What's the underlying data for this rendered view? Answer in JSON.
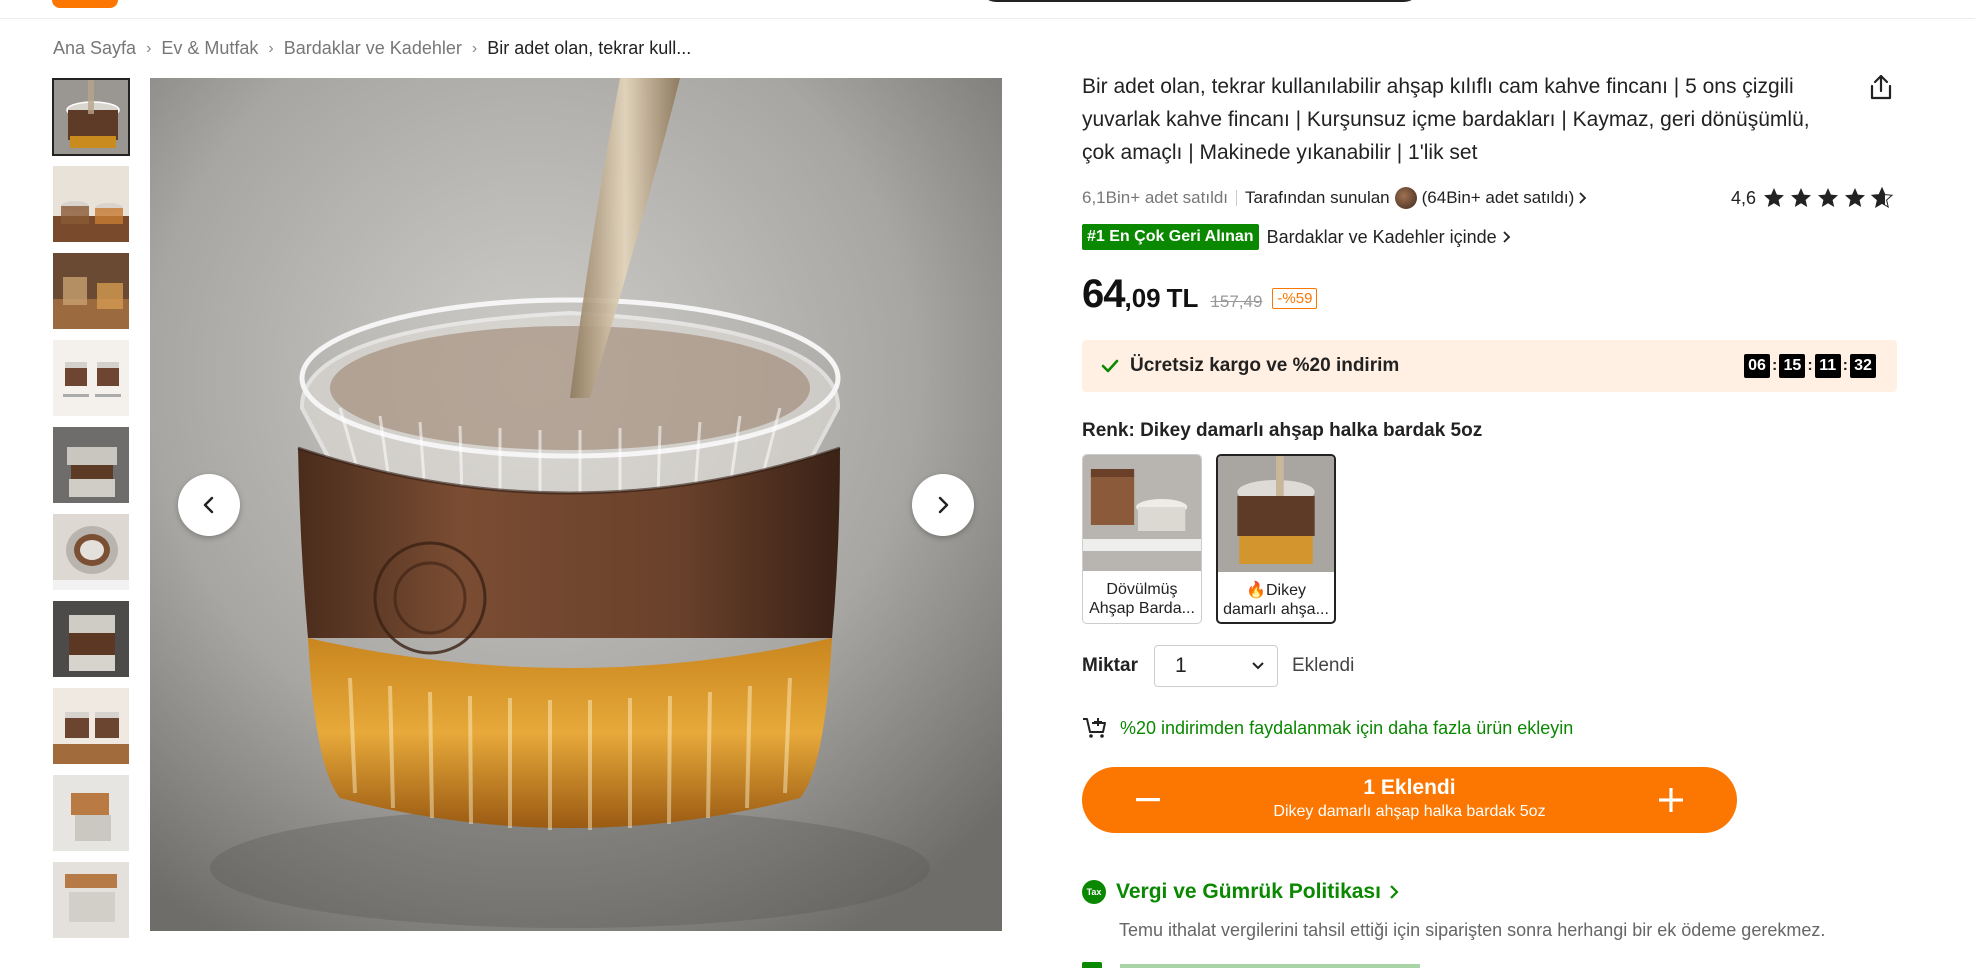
{
  "breadcrumb": [
    {
      "label": "Ana Sayfa"
    },
    {
      "label": "Ev & Mutfak"
    },
    {
      "label": "Bardaklar ve Kadehler"
    },
    {
      "label": "Bir adet olan, tekrar kull..."
    }
  ],
  "product": {
    "title": "Bir adet olan, tekrar kullanılabilir ahşap kılıflı cam kahve fincanı | 5 ons çizgili yuvarlak kahve fincanı | Kurşunsuz içme bardakları | Kaymaz, geri dönüşümlü, çok amaçlı | Makinede yıkanabilir | 1'lik set",
    "sold": "6,1Bin+ adet satıldı",
    "seller_prefix": "Tarafından sunulan",
    "seller_sold": "(64Bin+ adet satıldı)",
    "rating_value": "4,6",
    "rating": 4.6,
    "best_badge": "#1 En Çok Geri Alınan",
    "best_category": "Bardaklar ve Kadehler içinde",
    "price_main": "64",
    "price_decimal": ",09",
    "price_currency": "TL",
    "price_old": "157,49",
    "discount": "-%59"
  },
  "promo": {
    "text": "Ücretsiz kargo ve %20 indirim",
    "timer": [
      "06",
      "15",
      "11",
      "32"
    ]
  },
  "variant_section": {
    "label": "Renk: Dikey damarlı ahşap halka bardak 5oz",
    "options": [
      {
        "label": "Dövülmüş Ahşap Barda..."
      },
      {
        "flame": "🔥",
        "label": "Dikey damarlı ahşa..."
      }
    ]
  },
  "quantity": {
    "label": "Miktar",
    "value": "1",
    "status": "Eklendi"
  },
  "cart_hint": "%20 indirimden faydalanmak için daha fazla ürün ekleyin",
  "add_button": {
    "main": "1 Eklendi",
    "sub": "Dikey damarlı ahşap halka bardak 5oz"
  },
  "tax": {
    "icon_text": "Tax",
    "title": "Vergi ve Gümrük Politikası",
    "description": "Temu ithalat vergilerini tahsil ettiği için siparişten sonra herhangi bir ek ödeme gerekmez."
  },
  "colors": {
    "accent": "#fb7701",
    "green": "#0a8800",
    "promo_bg": "#fff0e3"
  }
}
